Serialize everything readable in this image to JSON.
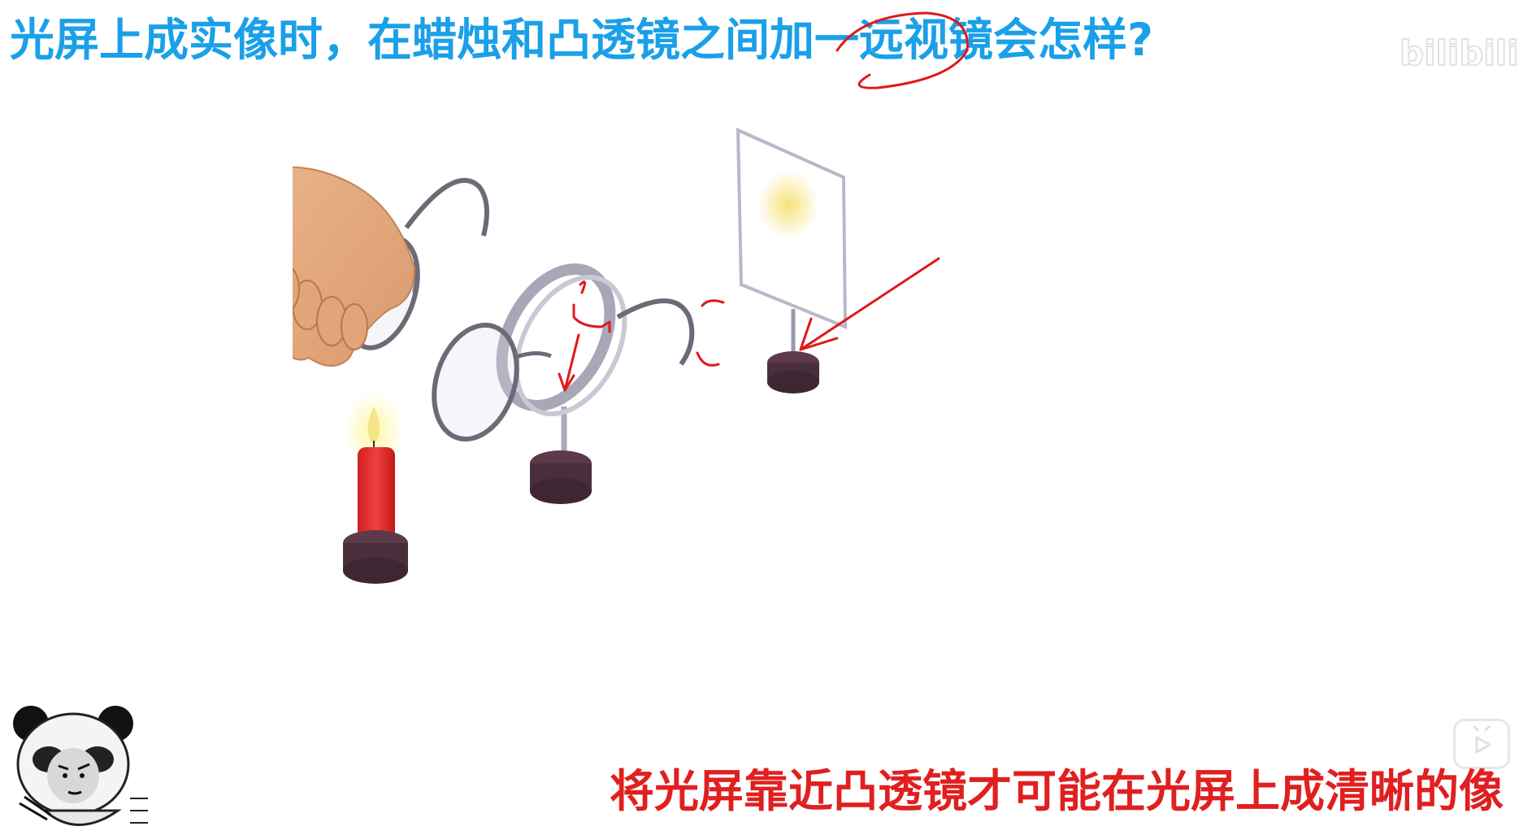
{
  "slide": {
    "question": "光屏上成实像时，在蜡烛和凸透镜之间加一远视镜会怎样?",
    "conclusion": "将光屏靠近凸透镜才可能在光屏上成清晰的像"
  },
  "watermark": {
    "text": "bilibili",
    "icon": "bilibili-logo-icon"
  },
  "player": {
    "play_icon": "tv-play-icon"
  },
  "colors": {
    "question": "#1aa0e8",
    "conclusion": "#e02020",
    "annotation": "#e01818",
    "candle": "#e52e2e",
    "base": "#4a2e3c"
  }
}
